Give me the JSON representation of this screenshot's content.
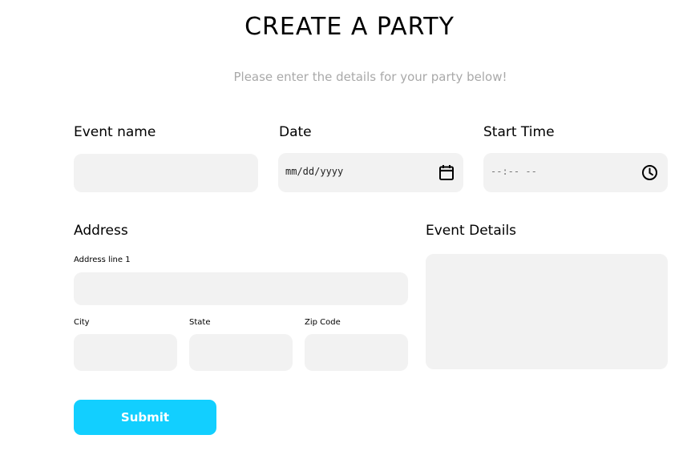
{
  "header": {
    "title": "CREATE A PARTY",
    "subtitle": "Please enter the details for your party below!"
  },
  "form": {
    "event_name": {
      "label": "Event name",
      "value": ""
    },
    "date": {
      "label": "Date",
      "placeholder": "mm/dd/yyyy",
      "icon": "calendar-icon"
    },
    "start_time": {
      "label": "Start Time",
      "placeholder": "--:-- --",
      "icon": "clock-icon"
    },
    "address": {
      "label": "Address",
      "line1_label": "Address line 1",
      "city_label": "City",
      "state_label": "State",
      "zip_label": "Zip Code"
    },
    "event_details": {
      "label": "Event Details",
      "value": ""
    },
    "submit_label": "Submit"
  },
  "colors": {
    "accent": "#12cfff",
    "field_bg": "#f2f2f2",
    "subtitle": "#a9a9a9"
  }
}
